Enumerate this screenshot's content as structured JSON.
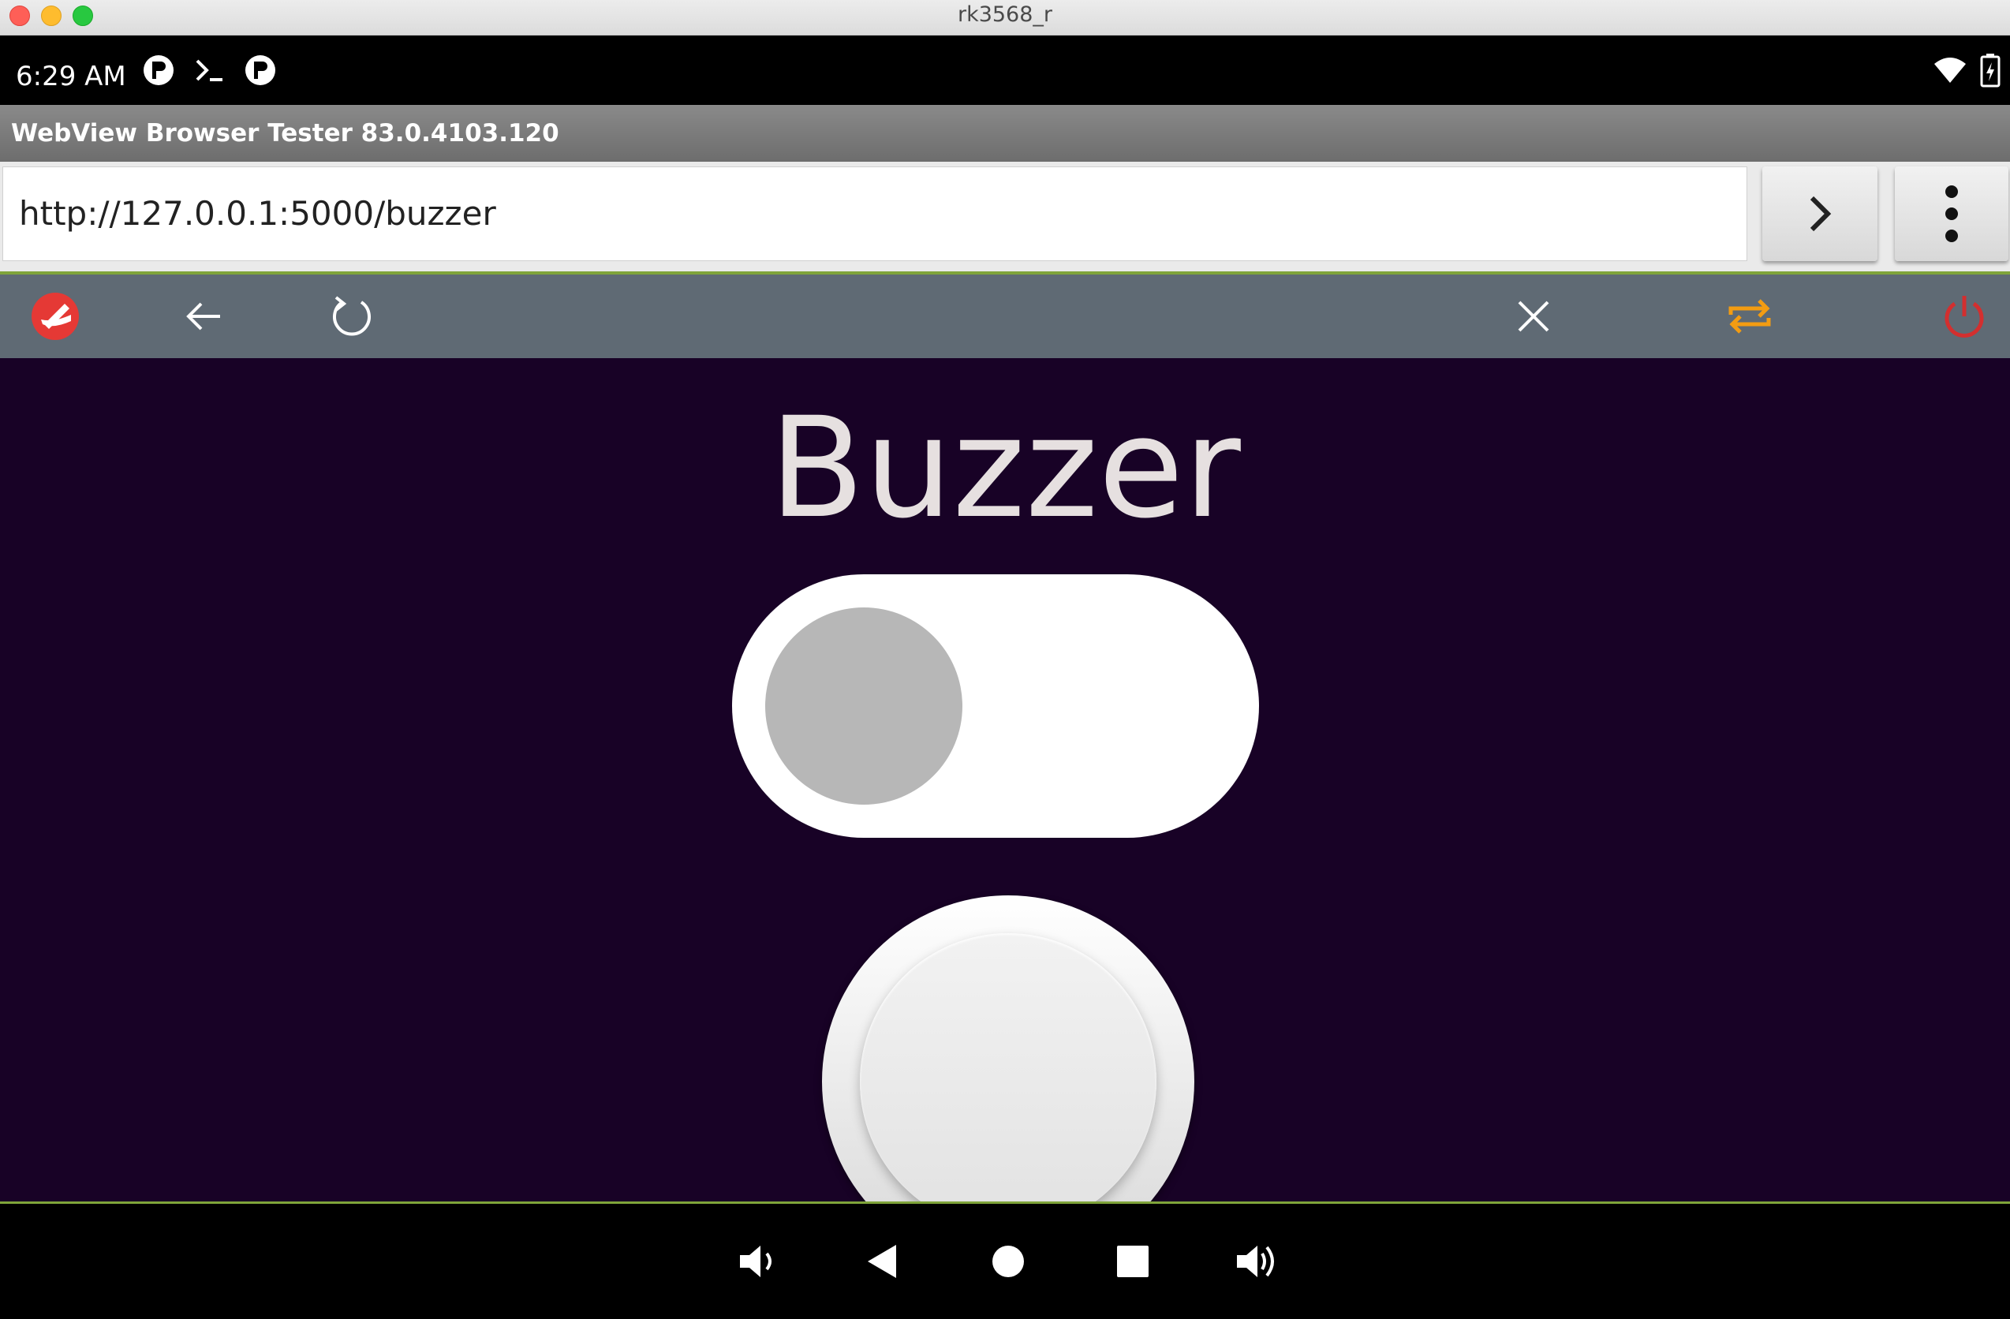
{
  "window": {
    "title": "rk3568_r"
  },
  "status_bar": {
    "time": "6:29 AM",
    "left_icons": [
      "notification-p-icon",
      "terminal-icon",
      "notification-p-icon"
    ],
    "right_icons": [
      "wifi-icon",
      "battery-icon"
    ]
  },
  "app": {
    "title": "WebView Browser Tester 83.0.4103.120"
  },
  "url_bar": {
    "value": "http://127.0.0.1:5000/buzzer"
  },
  "toolbar": {
    "icons": [
      "app-logo-icon",
      "back-arrow-icon",
      "reload-icon",
      "close-icon",
      "swap-icon",
      "power-icon"
    ],
    "colors": {
      "background": "#5f6a74",
      "swap": "#f39c12",
      "power": "#d32f2f",
      "logo": "#e53935"
    }
  },
  "page": {
    "title": "Buzzer",
    "background": "#180226",
    "toggle": {
      "state": "off"
    }
  },
  "nav_bar": {
    "icons": [
      "volume-down-icon",
      "back-icon",
      "home-icon",
      "recents-icon",
      "volume-up-icon"
    ]
  }
}
